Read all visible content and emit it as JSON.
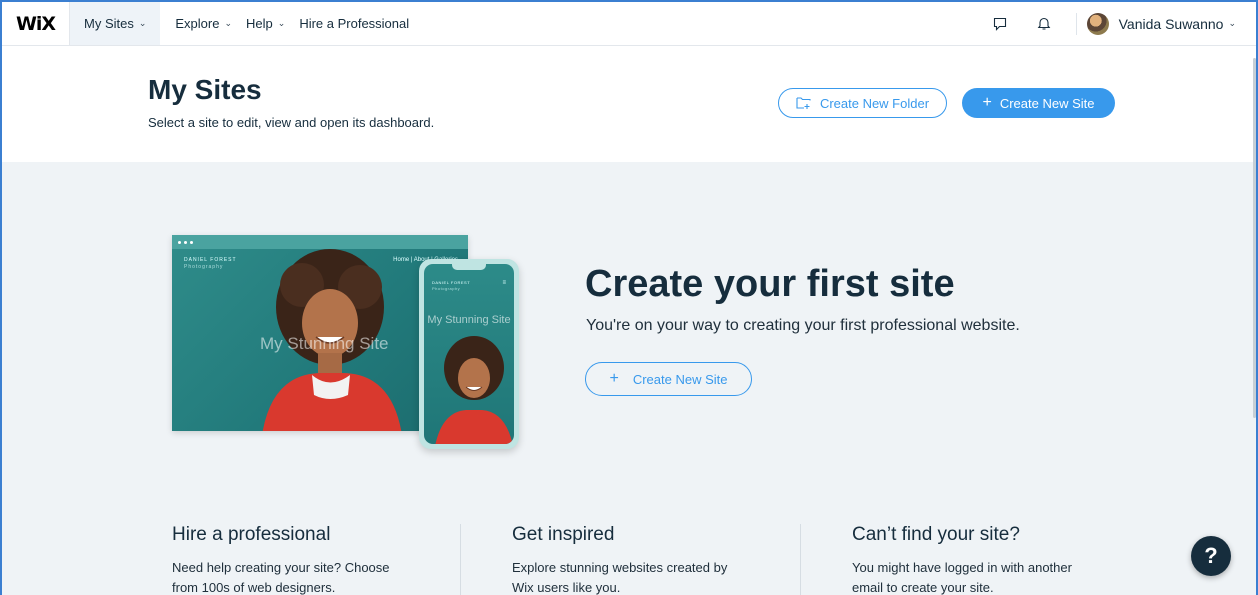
{
  "topbar": {
    "logo": "WiX",
    "nav": [
      {
        "label": "My Sites",
        "has_dropdown": true,
        "active": true
      },
      {
        "label": "Explore",
        "has_dropdown": true
      },
      {
        "label": "Help",
        "has_dropdown": true
      },
      {
        "label": "Hire a Professional",
        "has_dropdown": false
      }
    ],
    "icons": [
      "chat-icon",
      "bell-icon"
    ],
    "user_name": "Vanida Suwanno"
  },
  "header": {
    "title": "My Sites",
    "subtitle": "Select a site to edit, view and open its dashboard.",
    "create_folder_label": "Create New Folder",
    "create_site_label": "Create New Site"
  },
  "hero": {
    "title": "Create your first site",
    "subtitle": "You're on your way to creating your first professional website.",
    "button_label": "Create New Site",
    "preview": {
      "laptop_text": "My Stunning Site",
      "phone_text": "My Stunning Site",
      "brand": "DANIEL FOREST",
      "brand_sub": "Photography",
      "menu": "Home | About | Galleries"
    }
  },
  "columns": [
    {
      "title": "Hire a professional",
      "text_1": "Need help creating your site? Choose",
      "text_2": "from 100s of web designers."
    },
    {
      "title": "Get inspired",
      "text_1": "Explore stunning websites created by",
      "text_2": "Wix users like you."
    },
    {
      "title": "Can’t find your site?",
      "text_1": "You might have logged in with another",
      "text_2": "email to create your site."
    }
  ],
  "help_button": "?",
  "colors": {
    "accent": "#3899ec",
    "dark": "#162d3d",
    "page_bg": "#eff3f6",
    "preview_teal": "#21797a"
  }
}
